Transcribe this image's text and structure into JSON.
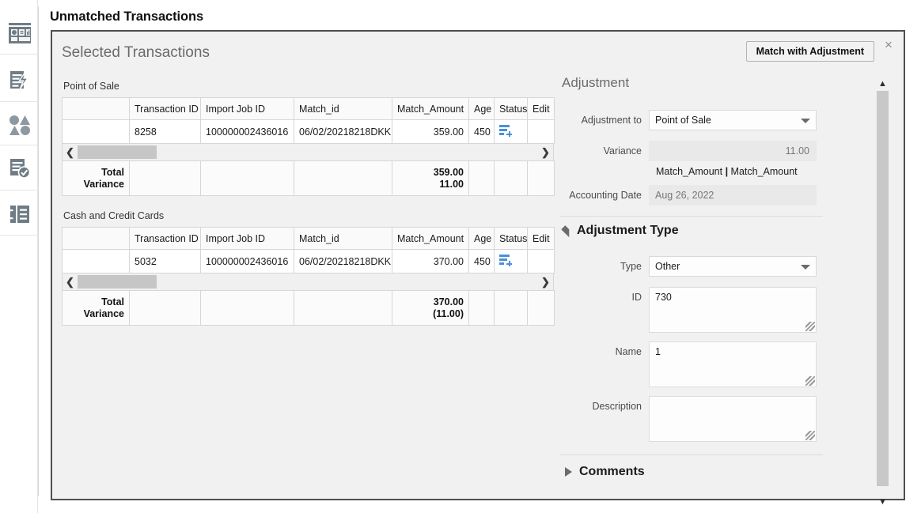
{
  "page": {
    "title": "Unmatched Transactions"
  },
  "sidebar": {
    "items": [
      {
        "name": "dashboard-icon",
        "label": "Dashboard"
      },
      {
        "name": "quick-actions-icon",
        "label": "Quick Actions"
      },
      {
        "name": "shapes-icon",
        "label": "Shapes"
      },
      {
        "name": "task-approved-icon",
        "label": "Approved Tasks"
      },
      {
        "name": "reports-icon",
        "label": "Reports"
      }
    ]
  },
  "dialog": {
    "title": "Selected Transactions",
    "match_button": "Match with Adjustment",
    "close_label": "×"
  },
  "tables": [
    {
      "caption": "Point of Sale",
      "columns": [
        "",
        "Transaction ID",
        "Import Job ID",
        "Match_id",
        "Match_Amount",
        "Age",
        "Status",
        "Edit"
      ],
      "rows": [
        {
          "select": "",
          "transaction_id": "8258",
          "import_job_id": "100000002436016",
          "match_id": "06/02/20218218DKK",
          "match_amount": "359.00",
          "age": "450",
          "status_icon": "list-add-icon",
          "edit": ""
        }
      ],
      "totals": {
        "label_line1": "Total",
        "label_line2": "Variance",
        "amount_line1": "359.00",
        "amount_line2": "11.00"
      }
    },
    {
      "caption": "Cash and Credit Cards",
      "columns": [
        "",
        "Transaction ID",
        "Import Job ID",
        "Match_id",
        "Match_Amount",
        "Age",
        "Status",
        "Edit"
      ],
      "rows": [
        {
          "select": "",
          "transaction_id": "5032",
          "import_job_id": "100000002436016",
          "match_id": "06/02/20218218DKK",
          "match_amount": "370.00",
          "age": "450",
          "status_icon": "list-add-icon",
          "edit": ""
        }
      ],
      "totals": {
        "label_line1": "Total",
        "label_line2": "Variance",
        "amount_line1": "370.00",
        "amount_line2": "(11.00)"
      }
    }
  ],
  "adjustment": {
    "title": "Adjustment",
    "adjustment_to_label": "Adjustment to",
    "adjustment_to_value": "Point of Sale",
    "variance_label": "Variance",
    "variance_value": "11.00",
    "match_link_left": "Match_Amount",
    "match_link_sep": "|",
    "match_link_right": "Match_Amount",
    "accounting_date_label": "Accounting Date",
    "accounting_date_value": "Aug 26, 2022"
  },
  "adjustment_type": {
    "title": "Adjustment Type",
    "type_label": "Type",
    "type_value": "Other",
    "id_label": "ID",
    "id_value": "730",
    "name_label": "Name",
    "name_value": "1",
    "description_label": "Description",
    "description_value": ""
  },
  "comments": {
    "title": "Comments"
  },
  "colors": {
    "accent": "#4a90d9",
    "dialog_border": "#4f4f4f",
    "panel_bg": "#f1f1f1",
    "icon_gray": "#6f7c85"
  }
}
